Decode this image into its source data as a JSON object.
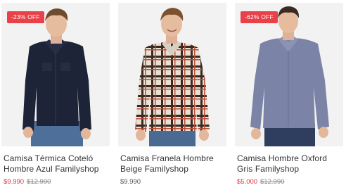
{
  "products": [
    {
      "badge": "-23% OFF",
      "name": "Camisa Térmica Coteló Hombre Azul Familyshop",
      "price_sale": "$9.990",
      "price_old": "$12.990",
      "image": "man-navy-corduroy-shirt"
    },
    {
      "name": "Camisa Franela Hombre Beige Familyshop",
      "price": "$9.990",
      "image": "man-plaid-flannel-shirt"
    },
    {
      "badge": "-62% OFF",
      "name": "Camisa Hombre Oxford Gris Familyshop",
      "price_sale": "$5.000",
      "price_old": "$12.990",
      "image": "man-gray-oxford-shirt"
    }
  ],
  "colors": {
    "badge": "#e8414a",
    "sale_price": "#e0353f",
    "old_price": "#888888"
  }
}
